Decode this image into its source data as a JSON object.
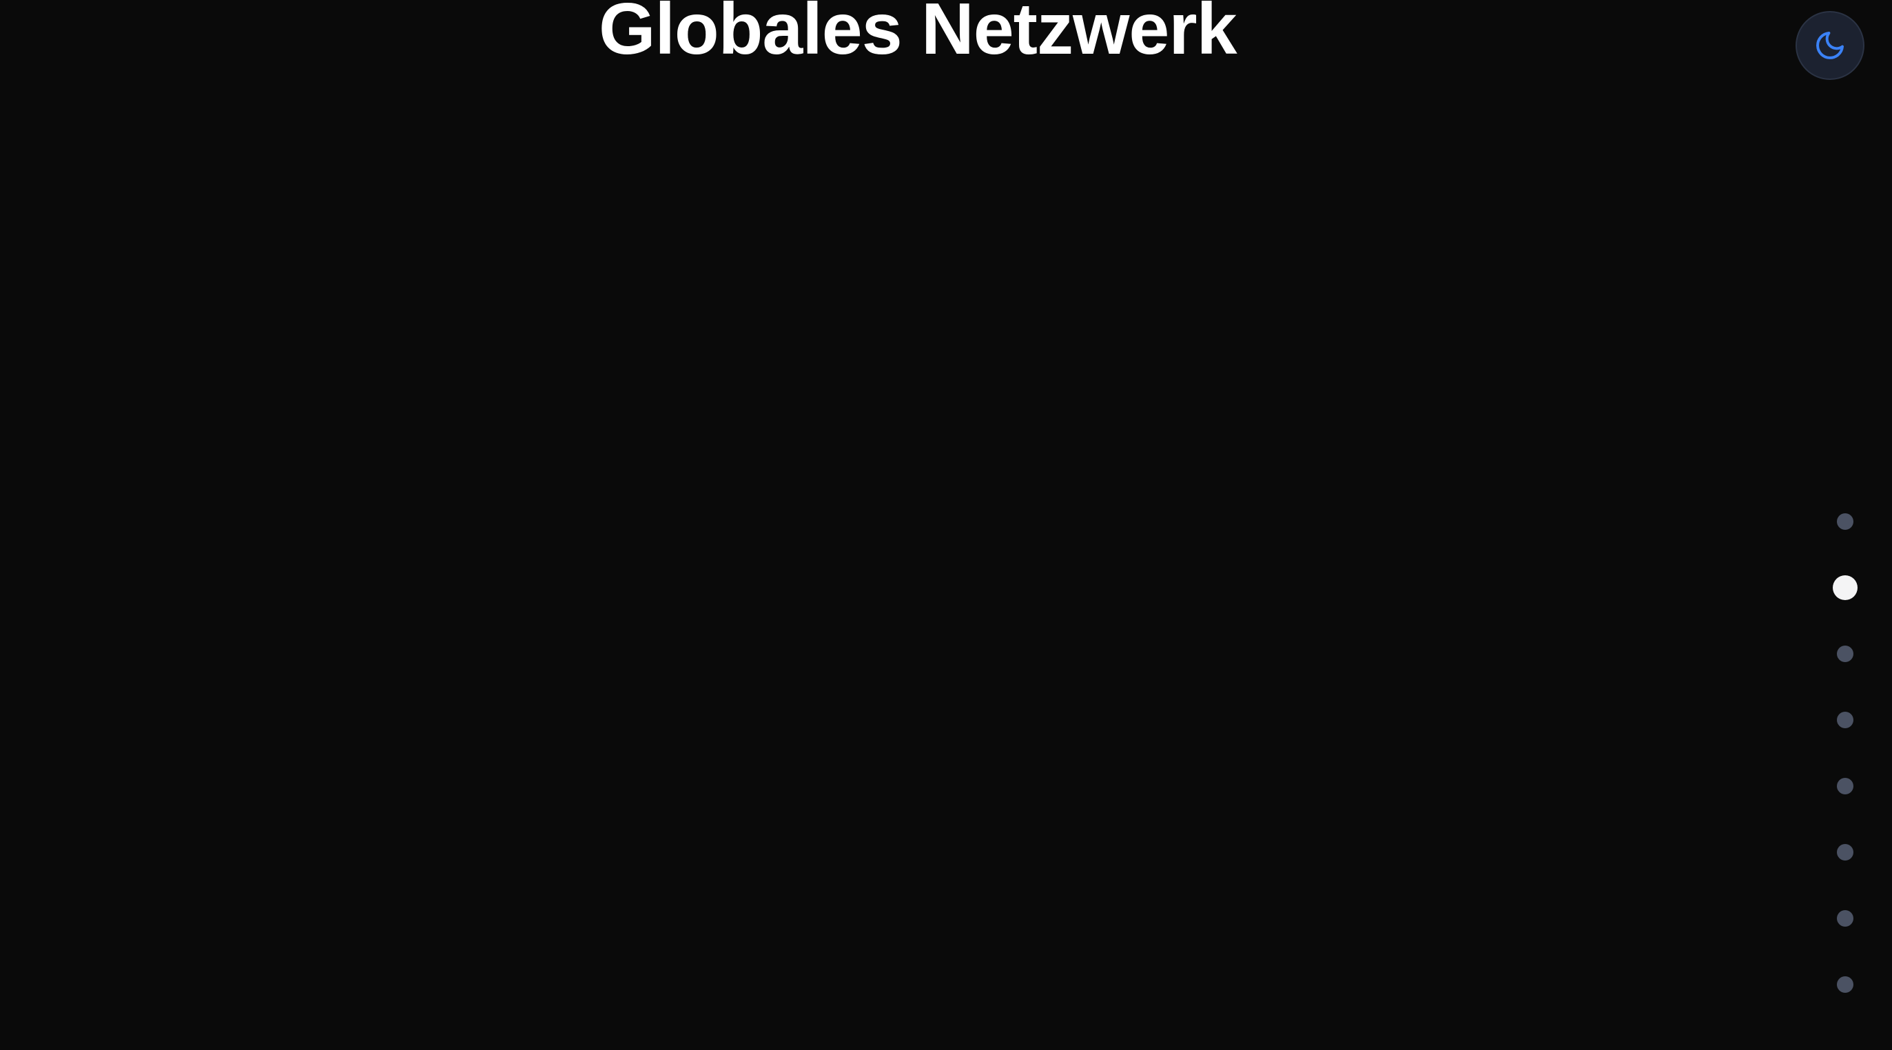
{
  "header": {
    "title": "Globales Netzwerk"
  },
  "theme_toggle": {
    "icon": "moon-icon",
    "icon_color": "#3b82f6"
  },
  "section_nav": {
    "count": 8,
    "active_index": 1,
    "active_color": "#f4f4f5",
    "inactive_color": "#4b5263"
  },
  "colors": {
    "background": "#0a0a0a",
    "title": "#ffffff",
    "toggle_bg": "#1c2230"
  }
}
